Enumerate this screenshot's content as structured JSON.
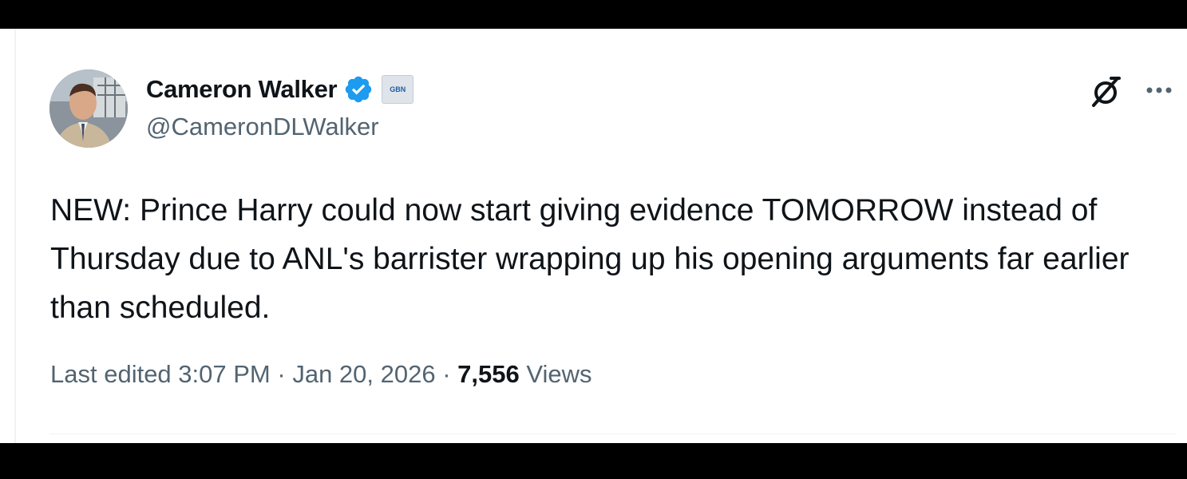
{
  "author": {
    "display_name": "Cameron Walker",
    "handle": "@CameronDLWalker",
    "verified_icon": "verified-badge-icon",
    "affiliate_icon": "gb-news-affiliate-badge",
    "affiliate_label": "GBN"
  },
  "actions": {
    "grok_icon": "grok-icon",
    "more_icon": "more-options-icon"
  },
  "tweet": {
    "text": "NEW: Prince Harry could now start giving evidence TOMORROW instead of Thursday due to ANL's barrister wrapping up his opening arguments far earlier than scheduled."
  },
  "meta": {
    "edited_label": "Last edited",
    "time": "3:07 PM",
    "separator": "·",
    "date": "Jan 20, 2026",
    "views_count": "7,556",
    "views_label": "Views"
  },
  "colors": {
    "text_primary": "#0f1419",
    "text_secondary": "#536471",
    "verified_blue": "#1d9bf0"
  }
}
